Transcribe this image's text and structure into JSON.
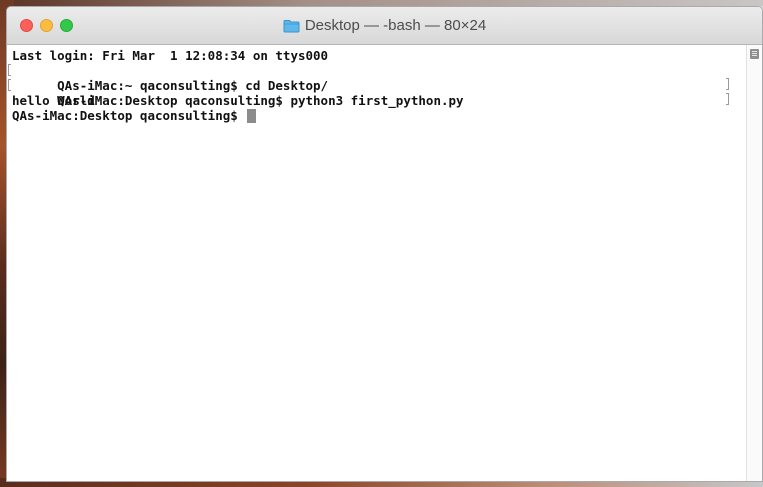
{
  "window": {
    "title": "Desktop — -bash — 80×24",
    "title_icon": "folder-icon"
  },
  "terminal": {
    "lines": [
      "Last login: Fri Mar  1 12:08:34 on ttys000",
      "QAs-iMac:~ qaconsulting$ cd Desktop/",
      "QAs-iMac:Desktop qaconsulting$ python3 first_python.py",
      "hello World",
      "QAs-iMac:Desktop qaconsulting$ "
    ]
  },
  "colors": {
    "close": "#fc605b",
    "minimize": "#fdbc40",
    "zoom": "#34c84a",
    "terminal_bg": "#ffffff",
    "terminal_text": "#111111",
    "cursor": "#8c8c8c",
    "folder": "#5fb8ec"
  }
}
